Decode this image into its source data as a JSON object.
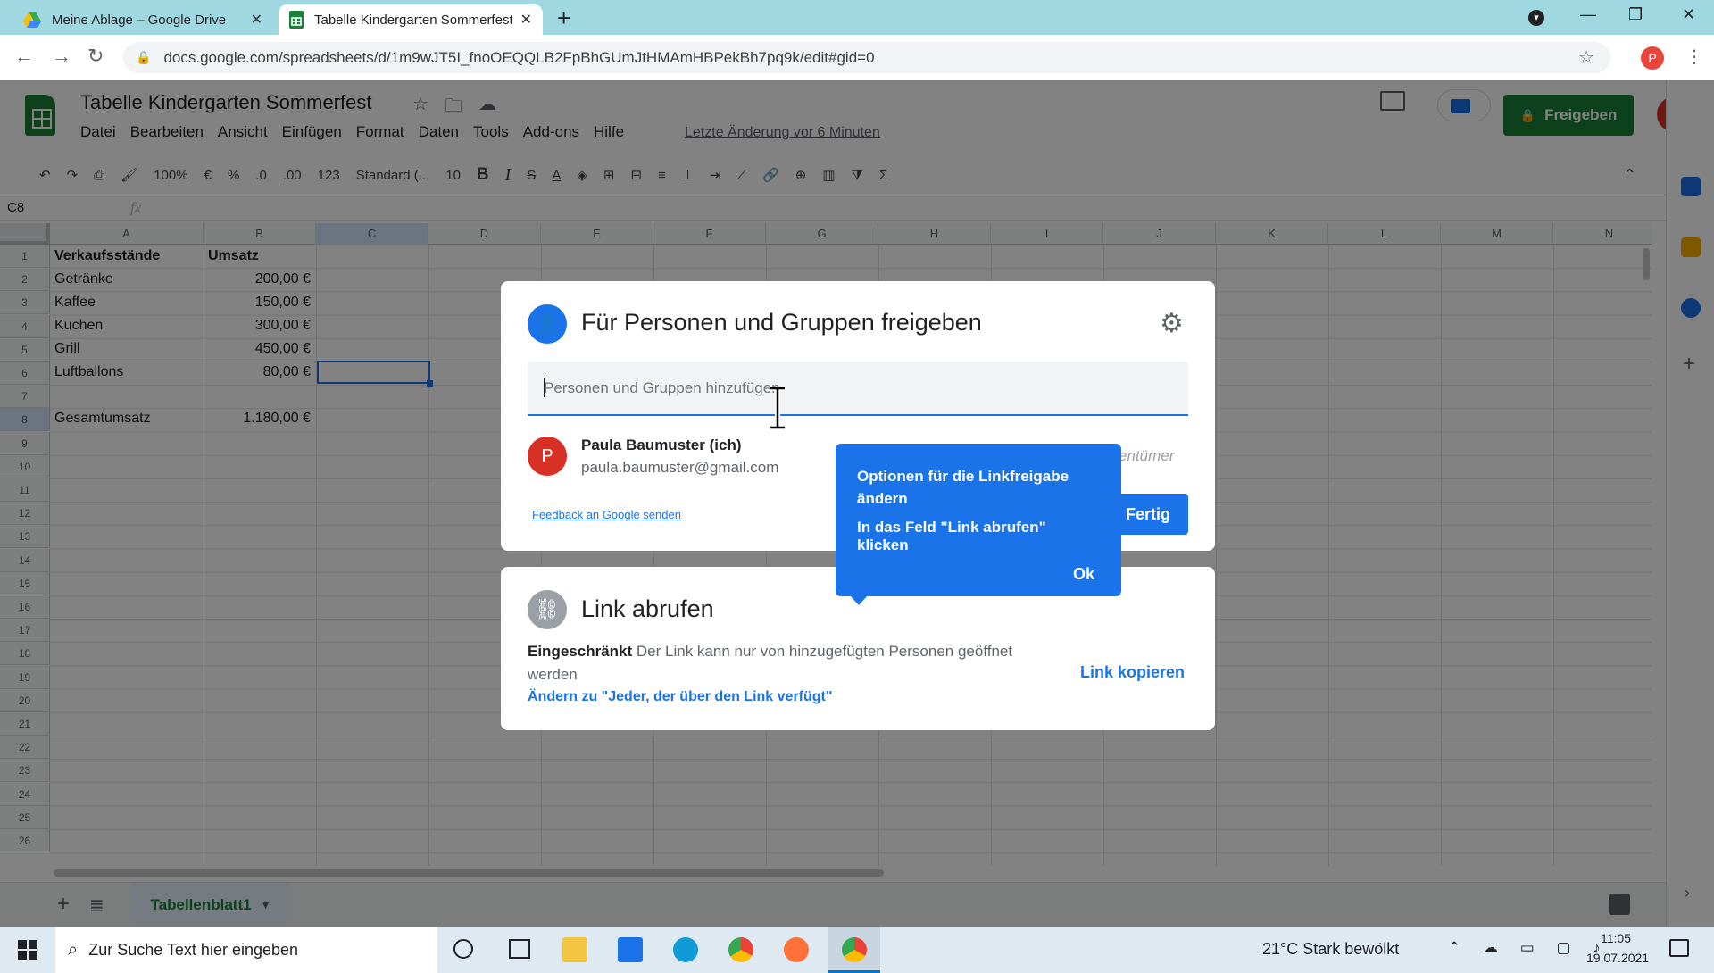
{
  "browser": {
    "tabs": [
      {
        "title": "Meine Ablage – Google Drive"
      },
      {
        "title": "Tabelle Kindergarten Sommerfest"
      }
    ],
    "url": "docs.google.com/spreadsheets/d/1m9wJT5I_fnoOEQQLB2FpBhGUmJtHMAmHBPekBh7pq9k/edit#gid=0",
    "profile_initial": "P"
  },
  "sheets": {
    "title": "Tabelle Kindergarten Sommerfest",
    "menu": [
      "Datei",
      "Bearbeiten",
      "Ansicht",
      "Einfügen",
      "Format",
      "Daten",
      "Tools",
      "Add-ons",
      "Hilfe"
    ],
    "last_edit": "Letzte Änderung vor 6 Minuten",
    "share_label": "Freigeben",
    "avatar_initial": "P",
    "toolbar": {
      "zoom": "100%",
      "currency": "€",
      "percent": "%",
      "decimal_less": ".0",
      "decimal_more": ".00",
      "number_format": "123",
      "font": "Standard (...",
      "font_size": "10"
    },
    "name_box": "C8",
    "fx": "fx",
    "columns": [
      "A",
      "B",
      "C",
      "D",
      "E",
      "F",
      "G",
      "H",
      "I",
      "J",
      "K",
      "L",
      "M",
      "N"
    ],
    "rows": [
      "1",
      "2",
      "3",
      "4",
      "5",
      "6",
      "7",
      "8",
      "9",
      "10",
      "11",
      "12",
      "13",
      "14",
      "15",
      "16",
      "17",
      "18",
      "19",
      "20",
      "21",
      "22",
      "23",
      "24",
      "25",
      "26"
    ],
    "cells": {
      "a1": "Verkaufsstände",
      "b1": "Umsatz",
      "a2": "Getränke",
      "b2": "200,00 €",
      "a3": "Kaffee",
      "b3": "150,00 €",
      "a4": "Kuchen",
      "b4": "300,00 €",
      "a5": "Grill",
      "b5": "450,00 €",
      "a6": "Luftballons",
      "b6": "80,00 €",
      "a8": "Gesamtumsatz",
      "b8": "1.180,00 €"
    },
    "sheet_tab": "Tabellenblatt1"
  },
  "share_dialog": {
    "heading": "Für Personen und Gruppen freigeben",
    "input_placeholder": "Personen und Gruppen hinzufügen",
    "owner": {
      "initial": "P",
      "name": "Paula Baumuster (ich)",
      "email": "paula.baumuster@gmail.com",
      "role": "entümer"
    },
    "feedback": "Feedback an Google senden",
    "done": "Fertig"
  },
  "link_dialog": {
    "heading": "Link abrufen",
    "restriction": "Eingeschränkt",
    "description": "Der Link kann nur von hinzugefügten Personen geöffnet werden",
    "change": "Ändern zu \"Jeder, der über den Link verfügt\"",
    "copy": "Link kopieren"
  },
  "tooltip": {
    "title": "Optionen für die Linkfreigabe ändern",
    "body": "In das Feld \"Link abrufen\" klicken",
    "ok": "Ok"
  },
  "taskbar": {
    "search_placeholder": "Zur Suche Text hier eingeben",
    "weather": "21°C  Stark bewölkt",
    "time": "11:05",
    "date": "19.07.2021"
  },
  "colors": {
    "accent": "#1a73e8",
    "sheets_green": "#188038",
    "avatar_red": "#d93025"
  }
}
